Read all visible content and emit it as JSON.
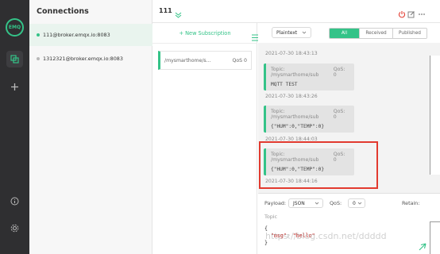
{
  "rail": {
    "logo_text": "EMQ",
    "icons": [
      "connections-icon",
      "plus-icon",
      "info-icon",
      "settings-icon"
    ]
  },
  "connections": {
    "title": "Connections",
    "items": [
      {
        "label": "111@broker.emqx.io:8083",
        "status": "connected",
        "selected": true
      },
      {
        "label": "1312321@broker.emqx.io:8083",
        "status": "disconnected",
        "selected": false
      }
    ]
  },
  "topbar": {
    "name": "111",
    "icons": [
      "power-icon",
      "edit-icon",
      "more-icon"
    ]
  },
  "subscriptions": {
    "new_label": "+ New Subscription",
    "items": [
      {
        "topic": "/mysmarthome/s...",
        "qos": "QoS 0"
      }
    ]
  },
  "filter": {
    "format": "Plaintext",
    "tabs": [
      "All",
      "Received",
      "Published"
    ],
    "active_tab": "All"
  },
  "messages": [
    {
      "kind": "timestamp",
      "time": "2021-07-30 18:43:13"
    },
    {
      "topic": "Topic: /mysmarthome/sub",
      "qos": "QoS: 0",
      "payload": "MQTT TEST",
      "time": "2021-07-30 18:43:26"
    },
    {
      "topic": "Topic: /mysmarthome/sub",
      "qos": "QoS: 0",
      "payload": "{\"HUM\":0,\"TEMP\":0}",
      "time": "2021-07-30 18:44:03"
    },
    {
      "topic": "Topic: /mysmarthome/sub",
      "qos": "QoS: 0",
      "payload": "{\"HUM\":0,\"TEMP\":0}",
      "time": "2021-07-30 18:44:16",
      "highlighted": true
    }
  ],
  "compose": {
    "payload_label": "Payload:",
    "payload_format": "JSON",
    "qos_label": "QoS:",
    "qos_value": "0",
    "retain_label": "Retain:",
    "topic_placeholder": "Topic",
    "code_open": "{",
    "code_key": "\"msg\"",
    "code_sep": ": ",
    "code_value": "\"hello\"",
    "code_close": "}"
  },
  "watermark": "https://blog.csdn.net/ddddd",
  "colors": {
    "accent": "#34c388",
    "highlight": "#e23a2f",
    "rail": "#2f2f31"
  }
}
